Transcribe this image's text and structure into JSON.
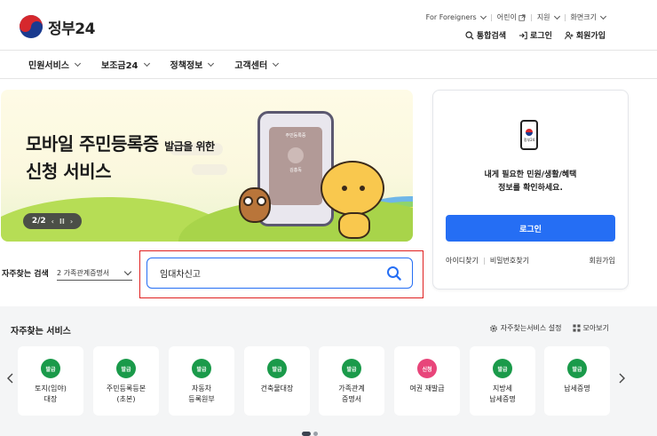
{
  "header": {
    "logo_text": "정부24",
    "util": [
      {
        "label": "For Foreigners",
        "icon": "chevron-down-icon"
      },
      {
        "label": "어린이",
        "icon": "external-link-icon"
      },
      {
        "label": "지원",
        "icon": "chevron-down-icon"
      },
      {
        "label": "화면크기",
        "icon": "chevron-down-icon"
      }
    ],
    "account": {
      "search_label": "통합검색",
      "login_label": "로그인",
      "signup_label": "회원가입"
    }
  },
  "nav": {
    "items": [
      "민원서비스",
      "보조금24",
      "정책정보",
      "고객센터"
    ]
  },
  "banner": {
    "title_line1": "모바일 주민등록증",
    "title_suffix": "발급을 위한",
    "title_line2": "신청 서비스",
    "pager": "2/2",
    "phone_card_title": "주민등록증",
    "phone_card_name": "김홍독"
  },
  "login_panel": {
    "icon_label": "정부24",
    "message_line1": "내게 필요한 민원/생활/혜택",
    "message_line2": "정보를 확인하세요.",
    "login_button": "로그인",
    "links": {
      "find_id": "아이디찾기",
      "find_pw": "비밀번호찾기",
      "signup": "회원가입"
    }
  },
  "frequent_search": {
    "label": "자주찾는 검색",
    "selected": "2 가족관계증명서",
    "query": "임대차신고"
  },
  "services": {
    "title": "자주찾는 서비스",
    "settings_label": "자주찾는서비스 설정",
    "view_all_label": "모아보기",
    "items": [
      {
        "badge": "발급",
        "label": "토지(임야)\n대장",
        "badge_color": "#1a9a4a"
      },
      {
        "badge": "발급",
        "label": "주민등록등본\n(초본)",
        "badge_color": "#1a9a4a"
      },
      {
        "badge": "발급",
        "label": "자동차\n등록원부",
        "badge_color": "#1a9a4a"
      },
      {
        "badge": "발급",
        "label": "건축물대장",
        "badge_color": "#1a9a4a"
      },
      {
        "badge": "발급",
        "label": "가족관계\n증명서",
        "badge_color": "#1a9a4a"
      },
      {
        "badge": "신청",
        "label": "여권 재발급",
        "badge_color": "#e8457a"
      },
      {
        "badge": "발급",
        "label": "지방세\n납세증명",
        "badge_color": "#1a9a4a"
      },
      {
        "badge": "발급",
        "label": "납세증명",
        "badge_color": "#1a9a4a"
      }
    ]
  },
  "colors": {
    "primary": "#256ef4",
    "issue_badge": "#1a9a4a",
    "apply_badge": "#e8457a",
    "highlight_box": "#e02020"
  }
}
